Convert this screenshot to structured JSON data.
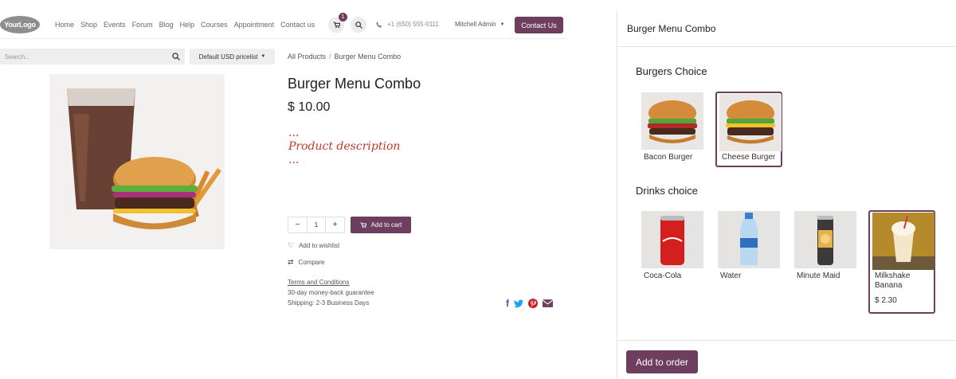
{
  "header": {
    "logo": "YourLogo",
    "nav": [
      "Home",
      "Shop",
      "Events",
      "Forum",
      "Blog",
      "Help",
      "Courses",
      "Appointment",
      "Contact us"
    ],
    "cart_count": "1",
    "phone": "+1 (650) 555-0111",
    "user": "Mitchell Admin",
    "contact_button": "Contact Us"
  },
  "search": {
    "placeholder": "Search...",
    "pricelist": "Default USD pricelist"
  },
  "breadcrumb": {
    "parent": "All Products",
    "separator": "/",
    "current": "Burger Menu Combo"
  },
  "product": {
    "title": "Burger Menu Combo",
    "price": "$ 10.00",
    "desc_dots_top": "...",
    "description": "Product description",
    "desc_dots_bottom": "...",
    "quantity": "1",
    "add_to_cart": "Add to cart",
    "wishlist": "Add to wishlist",
    "compare": "Compare",
    "terms": "Terms and Conditions",
    "guarantee": "30-day money-back guarantee",
    "shipping": "Shipping: 2-3 Business Days"
  },
  "dialog": {
    "title": "Burger Menu Combo",
    "sections": [
      {
        "title": "Burgers Choice",
        "items": [
          {
            "name": "Bacon Burger",
            "selected": false
          },
          {
            "name": "Cheese Burger",
            "selected": true
          }
        ]
      },
      {
        "title": "Drinks choice",
        "items": [
          {
            "name": "Coca-Cola",
            "selected": false
          },
          {
            "name": "Water",
            "selected": false
          },
          {
            "name": "Minute Maid",
            "selected": false
          },
          {
            "name": "Milkshake Banana",
            "price": "$ 2.30",
            "selected": true
          }
        ]
      }
    ],
    "add_to_order": "Add to order"
  },
  "colors": {
    "accent": "#6d3e5d",
    "description_red": "#c0392b",
    "facebook": "#3b5998",
    "twitter": "#1da1f2",
    "pinterest": "#cb2027",
    "email": "#6d3e5d"
  }
}
